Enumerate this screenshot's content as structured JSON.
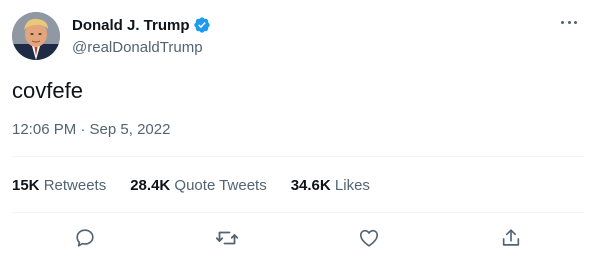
{
  "author": {
    "display_name": "Donald J. Trump",
    "handle": "@realDonaldTrump",
    "verified": true
  },
  "tweet": {
    "text": "covfefe",
    "timestamp": "12:06 PM · Sep 5, 2022"
  },
  "stats": [
    {
      "count": "15K",
      "label": "Retweets"
    },
    {
      "count": "28.4K",
      "label": "Quote Tweets"
    },
    {
      "count": "34.6K",
      "label": "Likes"
    }
  ],
  "icons": {
    "more": "more-icon",
    "verified": "verified-badge-icon",
    "reply": "reply-icon",
    "retweet": "retweet-icon",
    "like": "like-icon",
    "share": "share-icon"
  },
  "colors": {
    "primary_text": "#0f1419",
    "secondary_text": "#536471",
    "verified_blue": "#1d9bf0",
    "divider": "#eff3f4"
  }
}
